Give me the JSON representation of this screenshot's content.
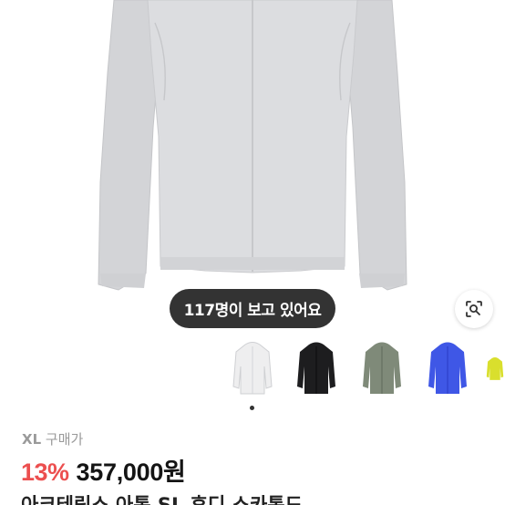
{
  "hero": {
    "image_description": "light gray zip-up windbreaker jacket",
    "jacket_color": "#dcdde0"
  },
  "viewers_badge": {
    "text": "117명이 보고 있어요"
  },
  "lens_button": {
    "icon": "visual-search-icon"
  },
  "thumbnails": [
    {
      "color": "#eeeeef",
      "accent": "#d4d5d8"
    },
    {
      "color": "#1d1d1f",
      "accent": "#0b0b0c"
    },
    {
      "color": "#7f8a79",
      "accent": "#5f6a5a"
    },
    {
      "color": "#3f57e6",
      "accent": "#2a3bc4"
    },
    {
      "color": "#d9df2d",
      "accent": "#b9c018"
    }
  ],
  "product": {
    "size": "XL",
    "price_type": "구매가",
    "discount": "13%",
    "price": "357,000원",
    "title": "아크테릭스 아톰 SL 후디 스카톰드"
  },
  "colors": {
    "discount": "#ec4f4f",
    "pill_bg": "#222222"
  }
}
